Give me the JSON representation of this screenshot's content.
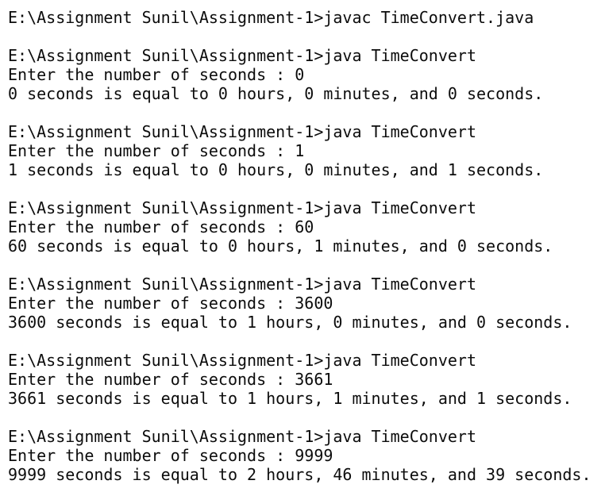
{
  "console": {
    "lines": [
      "E:\\Assignment Sunil\\Assignment-1>javac TimeConvert.java",
      "",
      "E:\\Assignment Sunil\\Assignment-1>java TimeConvert",
      "Enter the number of seconds : 0",
      "0 seconds is equal to 0 hours, 0 minutes, and 0 seconds.",
      "",
      "E:\\Assignment Sunil\\Assignment-1>java TimeConvert",
      "Enter the number of seconds : 1",
      "1 seconds is equal to 0 hours, 0 minutes, and 1 seconds.",
      "",
      "E:\\Assignment Sunil\\Assignment-1>java TimeConvert",
      "Enter the number of seconds : 60",
      "60 seconds is equal to 0 hours, 1 minutes, and 0 seconds.",
      "",
      "E:\\Assignment Sunil\\Assignment-1>java TimeConvert",
      "Enter the number of seconds : 3600",
      "3600 seconds is equal to 1 hours, 0 minutes, and 0 seconds.",
      "",
      "E:\\Assignment Sunil\\Assignment-1>java TimeConvert",
      "Enter the number of seconds : 3661",
      "3661 seconds is equal to 1 hours, 1 minutes, and 1 seconds.",
      "",
      "E:\\Assignment Sunil\\Assignment-1>java TimeConvert",
      "Enter the number of seconds : 9999",
      "9999 seconds is equal to 2 hours, 46 minutes, and 39 seconds."
    ]
  }
}
